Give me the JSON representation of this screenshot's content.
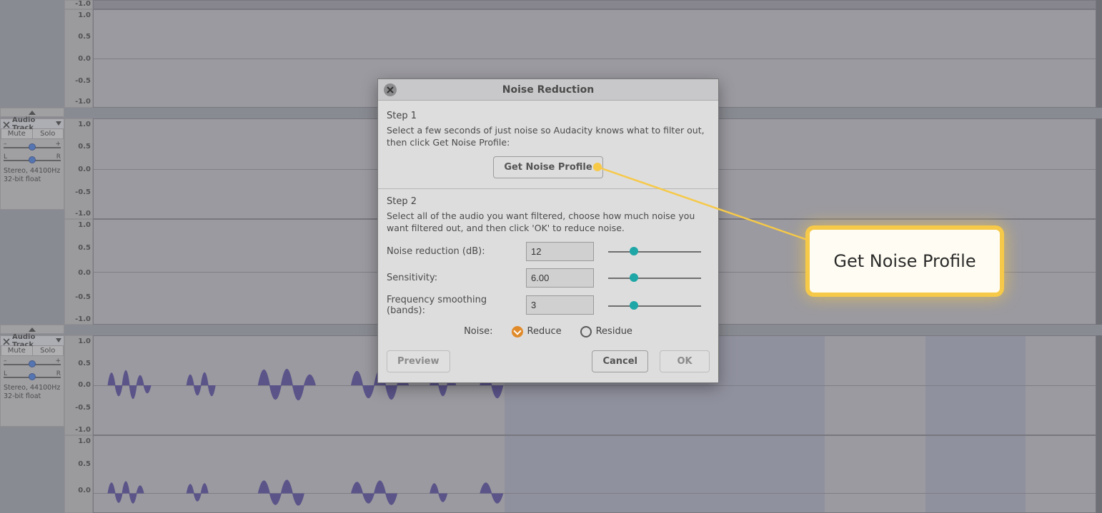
{
  "dialog": {
    "title": "Noise Reduction",
    "step1_label": "Step 1",
    "step1_desc": "Select a few seconds of just noise so Audacity knows what to filter out, then click Get Noise Profile:",
    "get_profile_label": "Get Noise Profile",
    "step2_label": "Step 2",
    "step2_desc": "Select all of the audio you want filtered, choose how much noise you want filtered out, and then click 'OK' to reduce noise.",
    "params": {
      "nr_label": "Noise reduction (dB):",
      "nr_value": "12",
      "sens_label": "Sensitivity:",
      "sens_value": "6.00",
      "freq_label": "Frequency smoothing (bands):",
      "freq_value": "3"
    },
    "noise_label": "Noise:",
    "reduce_label": "Reduce",
    "residue_label": "Residue",
    "preview_label": "Preview",
    "cancel_label": "Cancel",
    "ok_label": "OK"
  },
  "callout": {
    "text": "Get Noise Profile"
  },
  "track": {
    "title": "Audio Track",
    "mute": "Mute",
    "solo": "Solo",
    "gain_left": "–",
    "gain_right": "+",
    "pan_left": "L",
    "pan_right": "R",
    "info1": "Stereo, 44100Hz",
    "info2": "32-bit float"
  },
  "scale": {
    "p10": "1.0",
    "p05": "0.5",
    "z": "0.0",
    "n05": "-0.5",
    "n10": "-1.0"
  }
}
